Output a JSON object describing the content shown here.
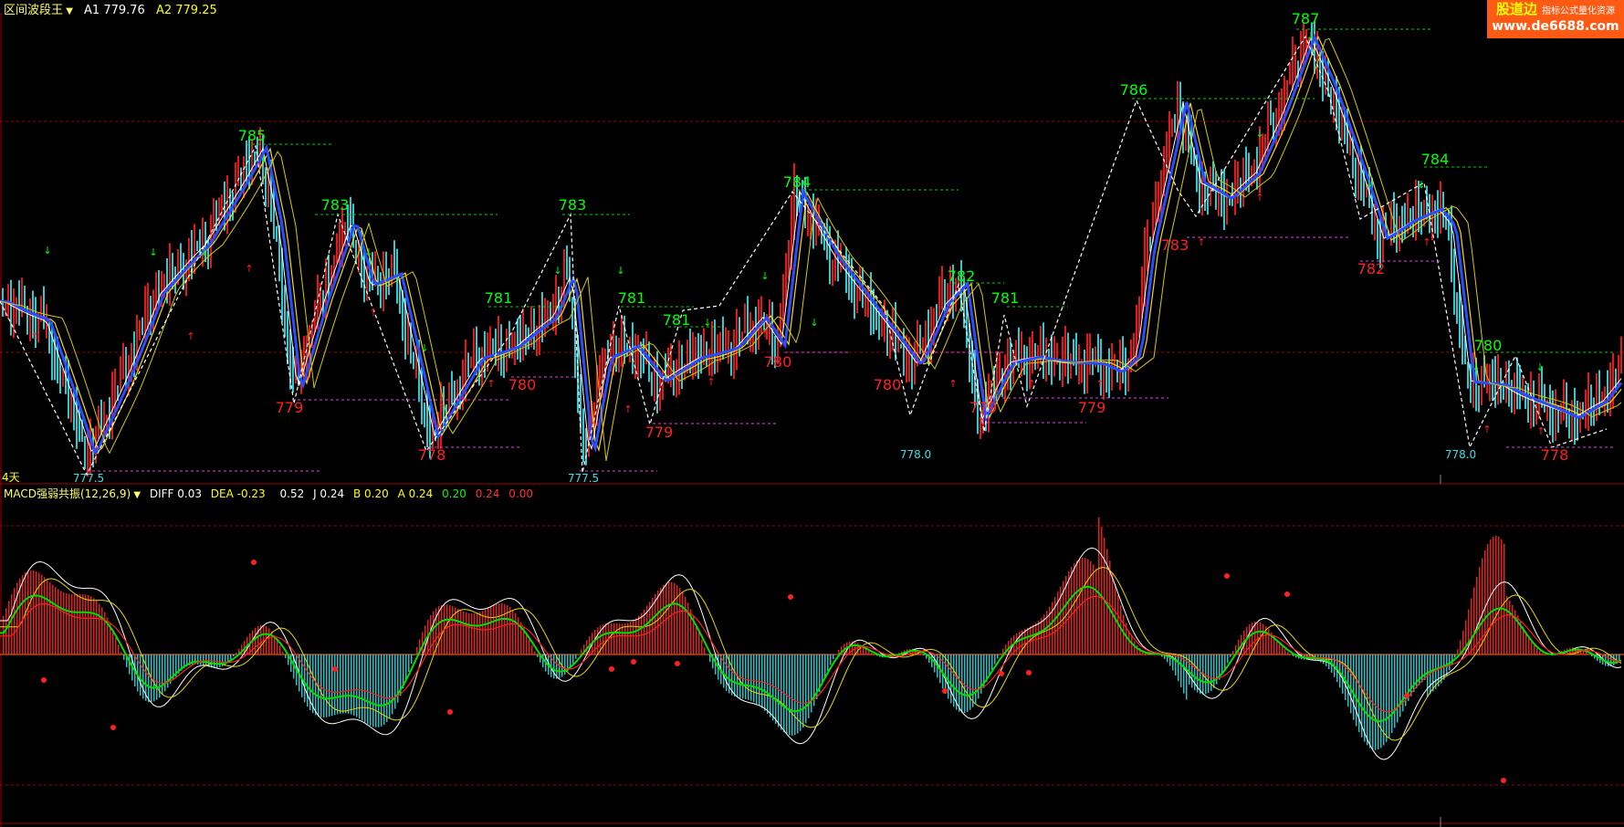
{
  "main_panel": {
    "indicator_name": "区间波段王",
    "a1_label": "A1 779.76",
    "a2_label": "A2 779.25",
    "period_label": "4天",
    "peak_labels": [
      "785",
      "783",
      "783",
      "784",
      "786",
      "787",
      "781",
      "781",
      "781",
      "782",
      "781",
      "784",
      "780"
    ],
    "trough_labels": [
      "779",
      "778",
      "780",
      "779",
      "780",
      "780",
      "779",
      "779",
      "783",
      "782",
      "778"
    ],
    "bottom_labels": [
      "777.5",
      "777.5",
      "778.0",
      "778.0"
    ]
  },
  "sub_panel": {
    "indicator_name": "MACD强弱共振(12,26,9)",
    "diff_label": "DIFF 0.03",
    "dea_label": "DEA -0.23",
    "v1": "0.52",
    "j_label": "J 0.24",
    "b_label": "B 0.20",
    "a_label": "A 0.24",
    "v2": "0.20",
    "v3": "0.24",
    "v4": "0.00"
  },
  "watermark": {
    "brand": "股道边",
    "tagline": "指标公式量化资源",
    "url": "www.de6688.com"
  },
  "colors": {
    "background": "#000000",
    "up_candle": "#ff1a1a",
    "down_candle": "#33e0e8",
    "peak_label": "#00ff00",
    "trough_label": "#ff2020",
    "header_text": "#ffff66",
    "panel_border": "#a00000",
    "watermark_bg": "#ff5a14"
  }
}
